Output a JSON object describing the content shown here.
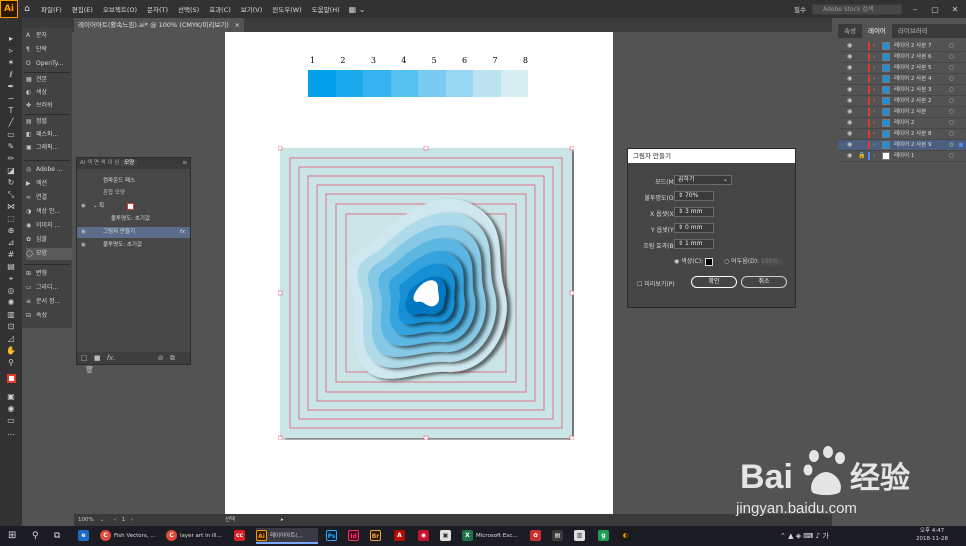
{
  "menubar": {
    "logo": "Ai",
    "items": [
      "파일(F)",
      "편집(E)",
      "오브젝트(O)",
      "문자(T)",
      "선택(S)",
      "효과(C)",
      "보기(V)",
      "윈도우(W)",
      "도움말(H)"
    ],
    "workspace": "필수",
    "search_placeholder": "Adobe Stock 검색"
  },
  "document": {
    "tab_title": "레이어아트(활속느낌).ai* @ 100% (CMYK/미리보기)",
    "close": "×"
  },
  "panel_strip": {
    "items": [
      {
        "label": "문자",
        "icon": "A"
      },
      {
        "label": "단락",
        "icon": "¶"
      },
      {
        "label": "OpenTy...",
        "icon": "O"
      },
      {
        "label": "견본",
        "icon": "▦"
      },
      {
        "label": "색상",
        "icon": "◐"
      },
      {
        "label": "브러쉬",
        "icon": "✤"
      },
      {
        "label": "정렬",
        "icon": "▤"
      },
      {
        "label": "패스파...",
        "icon": "◧"
      },
      {
        "label": "그래픽...",
        "icon": "▣"
      },
      {
        "label": "Adobe ...",
        "icon": "◎"
      },
      {
        "label": "액션",
        "icon": "▶"
      },
      {
        "label": "연결",
        "icon": "∞"
      },
      {
        "label": "색상 안...",
        "icon": "◑"
      },
      {
        "label": "이미지 ...",
        "icon": "◉"
      },
      {
        "label": "심볼",
        "icon": "✿"
      },
      {
        "label": "모양",
        "icon": "◯"
      },
      {
        "label": "변형",
        "icon": "⊞"
      },
      {
        "label": "그라디...",
        "icon": "▭"
      },
      {
        "label": "문서 정...",
        "icon": "≡"
      },
      {
        "label": "속성",
        "icon": "⊟"
      }
    ]
  },
  "appearance_panel": {
    "tabs": [
      "Ai",
      "색",
      "면",
      "색",
      "이",
      "심",
      "모양"
    ],
    "active_tab": "모양",
    "header": "컴파운드 패스",
    "rows": [
      {
        "label": "혼합 모양"
      },
      {
        "label": "획"
      },
      {
        "label": "불투명도: 초기값"
      },
      {
        "label": "그림자 만들기",
        "fx": "fx"
      },
      {
        "label": "불투명도: 초기값"
      }
    ],
    "footer": "fx."
  },
  "artwork": {
    "numbers": [
      "1",
      "2",
      "3",
      "4",
      "5",
      "6",
      "7",
      "8"
    ],
    "swatches": [
      "#00a0e9",
      "#18a9ec",
      "#35b3ee",
      "#55bff0",
      "#79cbf2",
      "#9ad7f3",
      "#bde3f1",
      "#d8eef2"
    ],
    "background_color": "#c9e5e6"
  },
  "layers_panel": {
    "tabs": [
      "속성",
      "레이어",
      "라이브러리"
    ],
    "active_tab": "레이어",
    "layers": [
      {
        "name": "레이어 2 사본 7"
      },
      {
        "name": "레이어 2 사본 6"
      },
      {
        "name": "레이어 2 사본 5"
      },
      {
        "name": "레이어 2 사본 4"
      },
      {
        "name": "레이어 2 사본 3"
      },
      {
        "name": "레이어 2 사본 2"
      },
      {
        "name": "레이어 2 사본"
      },
      {
        "name": "레이어 2"
      },
      {
        "name": "레이어 2 사본 8"
      },
      {
        "name": "레이어 2 사본 9"
      },
      {
        "name": "레이어 1"
      }
    ]
  },
  "dialog": {
    "title": "그림자 만들기",
    "mode_label": "모드(M):",
    "mode_value": "곱하기",
    "opacity_label": "불투명도(O):",
    "opacity_value": "70%",
    "x_label": "X 옵셋(X):",
    "x_value": "3 mm",
    "y_label": "Y 옵셋(Y):",
    "y_value": "0 mm",
    "blur_label": "흐림 효과(B):",
    "blur_value": "1 mm",
    "color_label": "색상(C):",
    "darkness_label": "어두움(D):",
    "darkness_value": "100%",
    "preview_label": "미리보기(P)",
    "ok_label": "확인",
    "cancel_label": "취소"
  },
  "statusbar": {
    "zoom": "100%",
    "page": "1",
    "tool": "선택"
  },
  "taskbar": {
    "items": [
      {
        "label": "Fish Vectors, ...",
        "icon": "C",
        "color": "#e24b3a"
      },
      {
        "label": "layer art in ill...",
        "icon": "C",
        "color": "#e24b3a"
      },
      {
        "label": "레이어아트(...",
        "icon": "Ai",
        "color": "#ff7c00"
      },
      {
        "label": "Microsoft Exc...",
        "icon": "X",
        "color": "#1e7145"
      }
    ],
    "time": "오후 4:47",
    "date": "2018-11-28"
  },
  "watermark": {
    "brand_cn": "经验",
    "url": "jingyan.baidu.com"
  }
}
